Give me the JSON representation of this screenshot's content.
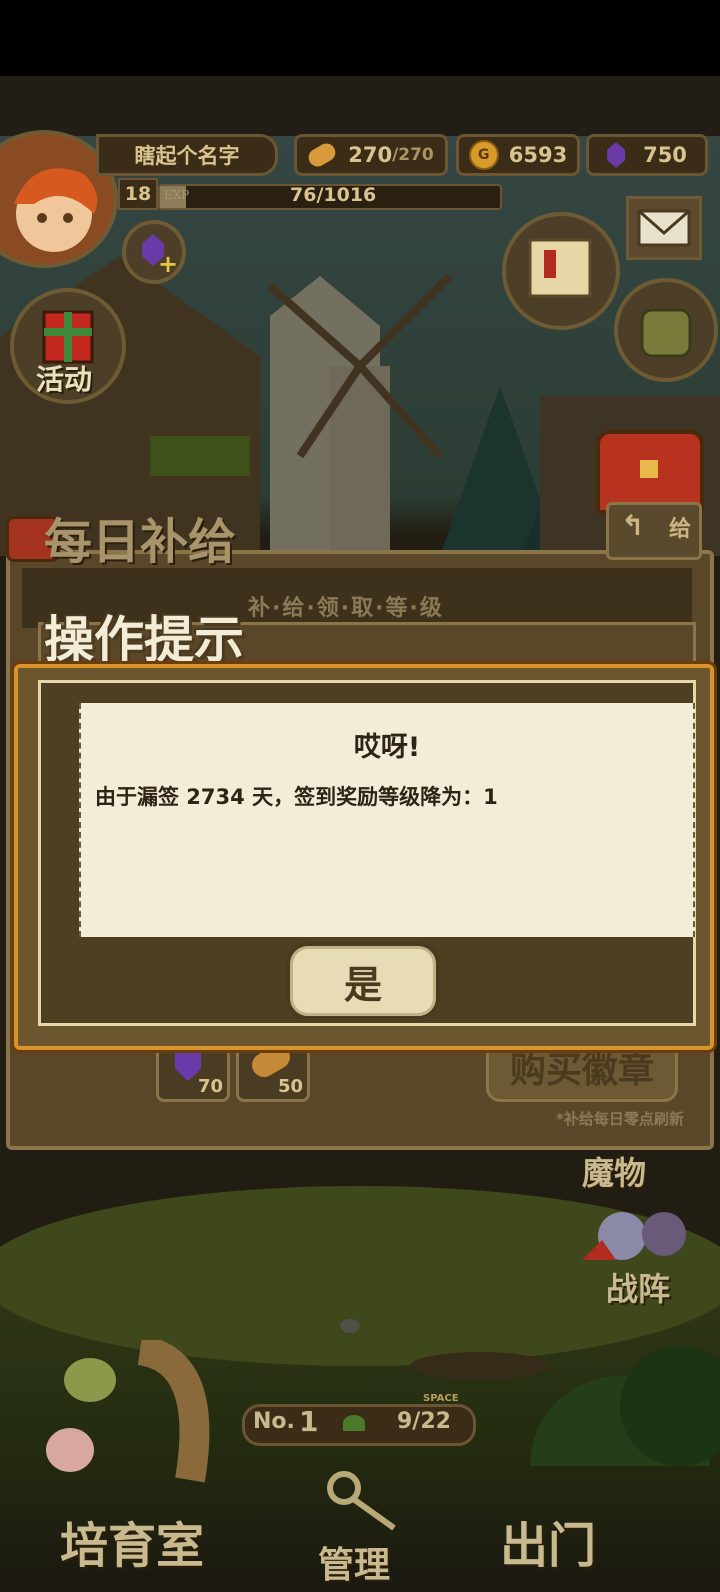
{
  "hud": {
    "player_name": "瞎起个名字",
    "stamina": "270",
    "stamina_max": "/270",
    "gold": "6593",
    "gems": "750",
    "level": "18",
    "exp_label": "EXP",
    "exp": "76/1016"
  },
  "side_buttons": {
    "event": "活动"
  },
  "daily_panel": {
    "title": "每日补给",
    "subtitle": "补·给·领·取·等·级",
    "return_label": "给",
    "gem_reward": "70",
    "bread_reward": "50",
    "buy_badge": "购买徽章",
    "refresh_note": "*补给每日零点刷新"
  },
  "dialog": {
    "banner": "操作提示",
    "heading": "哎呀!",
    "message": "由于漏签 2734 天，签到奖励等级降为：1",
    "confirm": "是"
  },
  "right_menu": {
    "monsters": "魔物",
    "formation": "战阵"
  },
  "bottom": {
    "rank_prefix": "No.",
    "rank": "1",
    "space_label": "SPACE",
    "space": "9/22",
    "nursery": "培育室",
    "manage": "管理",
    "go_out": "出门"
  },
  "colors": {
    "dialog_border": "#d9932b",
    "paper": "#f3ecd6",
    "text_dark": "#4a3a1f"
  }
}
